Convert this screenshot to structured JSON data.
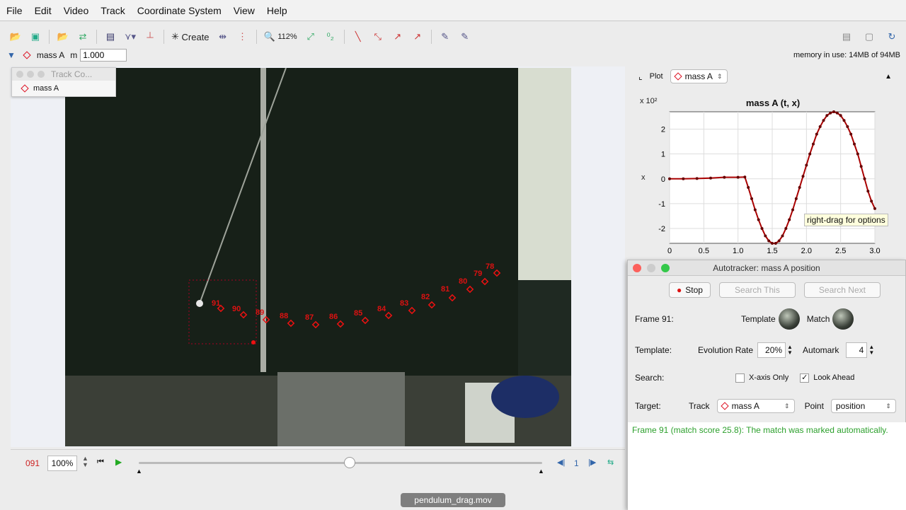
{
  "menu": [
    "File",
    "Edit",
    "Video",
    "Track",
    "Coordinate System",
    "View",
    "Help"
  ],
  "toolbar": {
    "create_label": "Create",
    "zoom_label": "112%"
  },
  "trackbar": {
    "track_name": "mass A",
    "mass_label": "m",
    "mass_value": "1.000",
    "memory": "memory in use: 14MB of 94MB"
  },
  "track_control": {
    "title": "Track Co...",
    "item": "mass A"
  },
  "overlay_labels": [
    "91",
    "90",
    "89",
    "88",
    "87",
    "86",
    "85",
    "84",
    "83",
    "82",
    "81",
    "80",
    "79",
    "78"
  ],
  "player": {
    "frame": "091",
    "zoom": "100%",
    "step": "1"
  },
  "plot": {
    "plot_label": "Plot",
    "track": "mass A",
    "multiplier": "x 10²",
    "tooltip": "right-drag for options"
  },
  "chart_data": {
    "type": "line",
    "title": "mass A (t, x)",
    "xlabel": "",
    "ylabel": "x",
    "xlim": [
      0,
      3.0
    ],
    "ylim": [
      -2.6,
      2.7
    ],
    "xticks": [
      "0",
      "0.5",
      "1.0",
      "1.5",
      "2.0",
      "2.5",
      "3.0"
    ],
    "yticks": [
      "2",
      "1",
      "0",
      "-1",
      "-2"
    ],
    "series": [
      {
        "x": [
          0.0,
          0.2,
          0.4,
          0.6,
          0.8,
          1.0,
          1.1,
          1.15,
          1.2,
          1.25,
          1.3,
          1.35,
          1.4,
          1.45,
          1.5,
          1.55,
          1.6,
          1.65,
          1.7,
          1.75,
          1.8,
          1.85,
          1.9,
          1.95,
          2.0,
          2.05,
          2.1,
          2.15,
          2.2,
          2.25,
          2.3,
          2.35,
          2.4,
          2.45,
          2.5,
          2.55,
          2.6,
          2.65,
          2.7,
          2.75,
          2.8,
          2.85,
          2.9,
          2.95,
          3.0
        ],
        "values": [
          0.0,
          0.0,
          0.01,
          0.03,
          0.06,
          0.06,
          0.07,
          -0.35,
          -0.8,
          -1.25,
          -1.65,
          -2.0,
          -2.3,
          -2.5,
          -2.6,
          -2.6,
          -2.5,
          -2.3,
          -2.0,
          -1.65,
          -1.25,
          -0.8,
          -0.35,
          0.1,
          0.55,
          1.0,
          1.4,
          1.8,
          2.1,
          2.35,
          2.55,
          2.65,
          2.7,
          2.65,
          2.55,
          2.35,
          2.1,
          1.8,
          1.4,
          1.0,
          0.5,
          0.0,
          -0.5,
          -0.9,
          -1.2
        ]
      }
    ]
  },
  "autotracker": {
    "title": "Autotracker: mass A position",
    "stop": "Stop",
    "search_this": "Search This",
    "search_next": "Search Next",
    "frame_label": "Frame 91:",
    "template_label": "Template",
    "match_label": "Match",
    "template_row": "Template:",
    "evolution_label": "Evolution Rate",
    "evolution_value": "20%",
    "automark_label": "Automark",
    "automark_value": "4",
    "search_row": "Search:",
    "xaxis_only": "X-axis Only",
    "look_ahead": "Look Ahead",
    "target_row": "Target:",
    "track_label": "Track",
    "track_value": "mass A",
    "point_label": "Point",
    "point_value": "position",
    "status": "Frame 91 (match score 25.8): The match was marked automatically."
  },
  "video_tab": "pendulum_drag.mov"
}
